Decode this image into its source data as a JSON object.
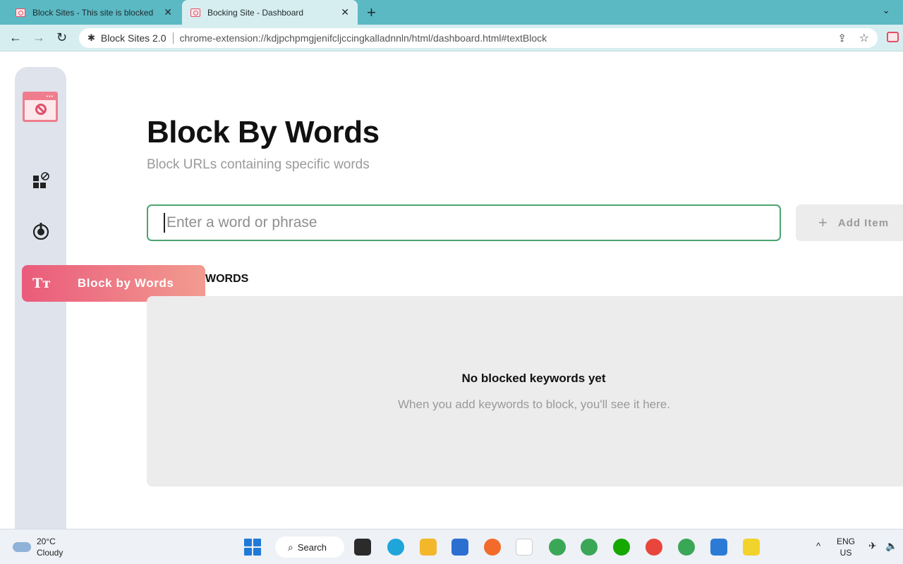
{
  "browser": {
    "tabs": [
      {
        "title": "Block Sites - This site is blocked",
        "active": false
      },
      {
        "title": "Bocking Site - Dashboard",
        "active": true
      }
    ],
    "new_tab_label": "+",
    "tab_menu_icon": "chevron-down-icon",
    "omnibox": {
      "origin": "Block Sites 2.0",
      "url": "chrome-extension://kdjpchpmgjenifcljccingkalladnnln/html/dashboard.html#textBlock"
    },
    "colors": {
      "tab_strip": "#5bb9c4",
      "toolbar": "#d7eef1"
    }
  },
  "sidebar": {
    "logo": "block-sites-logo",
    "items": [
      {
        "icon": "block-sites-icon"
      },
      {
        "icon": "focus-mode-icon"
      },
      {
        "icon": "text-icon",
        "label": "Block by Words",
        "tt": "Tт",
        "active": true
      }
    ],
    "colors": {
      "background": "#dfe3ec",
      "active_gradient_start": "#ea5b7b",
      "active_gradient_end": "#f29b90"
    }
  },
  "main": {
    "title": "Block By Words",
    "subtitle": "Block URLs containing specific words",
    "input_placeholder": "Enter a word or phrase",
    "input_value": "",
    "add_button_label": "Add Item",
    "section_label": "WORDS",
    "empty_state": {
      "title": "No blocked keywords yet",
      "subtitle": "When you add keywords to block, you'll see it here."
    },
    "colors": {
      "input_border": "#4ba56f"
    }
  },
  "taskbar": {
    "weather": {
      "temp": "20°C",
      "condition": "Cloudy"
    },
    "search_label": "Search",
    "lang_top": "ENG",
    "lang_bottom": "US"
  }
}
